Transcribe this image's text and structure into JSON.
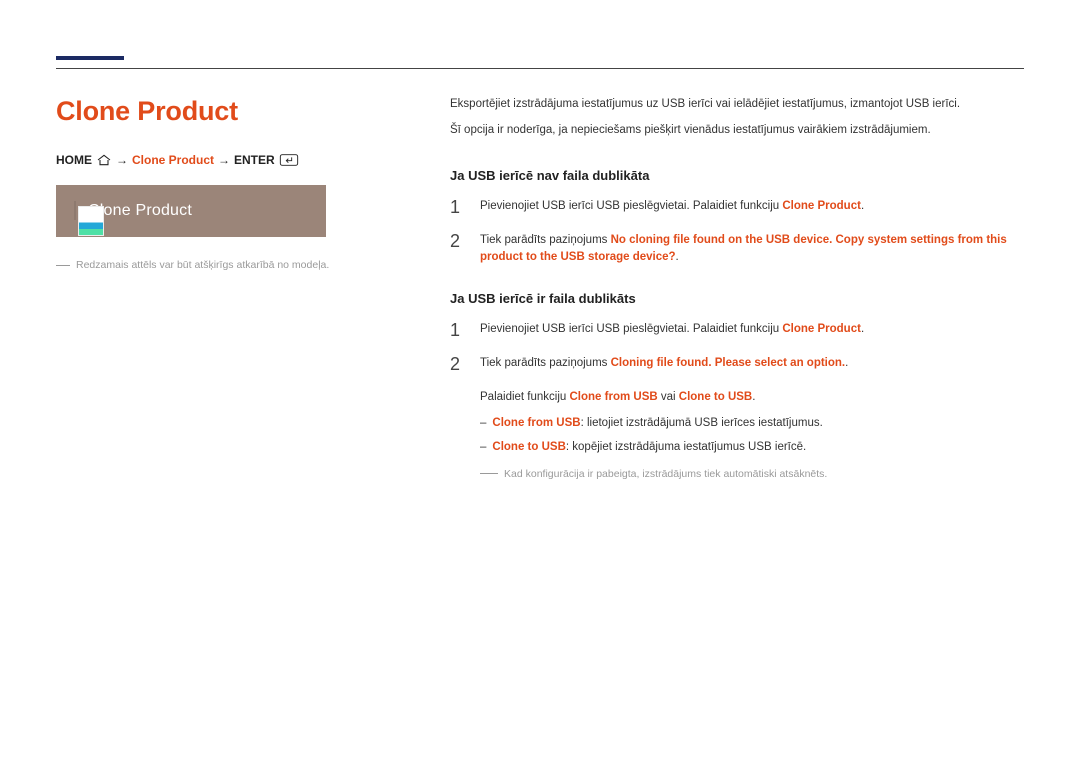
{
  "title": "Clone Product",
  "breadcrumb": {
    "home": "HOME",
    "arrow": "→",
    "clone": "Clone Product",
    "enter": "ENTER"
  },
  "screenshot": {
    "label": "Clone Product"
  },
  "left_note": "Redzamais attēls var būt atšķirīgs atkarībā no modeļa.",
  "intro": {
    "p1": "Eksportējiet izstrādājuma iestatījumus uz USB ierīci vai ielādējiet iestatījumus, izmantojot USB ierīci.",
    "p2": "Šī opcija ir noderīga, ja nepieciešams piešķirt vienādus iestatījumus vairākiem izstrādājumiem."
  },
  "secA": {
    "heading": "Ja USB ierīcē nav faila dublikāta",
    "s1_pre": "Pievienojiet USB ierīci USB pieslēgvietai. Palaidiet funkciju ",
    "s1_hl": "Clone Product",
    "s1_post": ".",
    "s2_pre": "Tiek parādīts paziņojums ",
    "s2_hl": "No cloning file found on the USB device. Copy system settings from this product to the USB storage device?",
    "s2_post": "."
  },
  "secB": {
    "heading": "Ja USB ierīcē ir faila dublikāts",
    "s1_pre": "Pievienojiet USB ierīci USB pieslēgvietai. Palaidiet funkciju ",
    "s1_hl": "Clone Product",
    "s1_post": ".",
    "s2_pre": "Tiek parādīts paziņojums ",
    "s2_hl": "Cloning file found. Please select an option.",
    "s2_post": ".",
    "sub_pre": "Palaidiet funkciju ",
    "sub_hl1": "Clone from USB",
    "sub_mid": " vai ",
    "sub_hl2": "Clone to USB",
    "sub_post": ".",
    "b1_hl": "Clone from USB",
    "b1_txt": ": lietojiet izstrādājumā USB ierīces iestatījumus.",
    "b2_hl": "Clone to USB",
    "b2_txt": ": kopējiet izstrādājuma iestatījumus USB ierīcē.",
    "final": "Kad konfigurācija ir pabeigta, izstrādājums tiek automātiski atsāknēts."
  },
  "nums": {
    "one": "1",
    "two": "2"
  },
  "dash": "‒"
}
